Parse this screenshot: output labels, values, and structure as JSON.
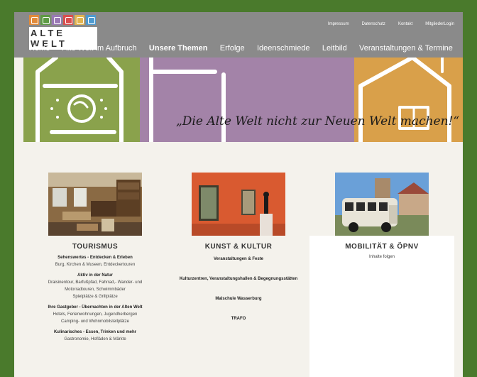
{
  "logo": {
    "text": "ALTE WELT",
    "tile_colors": [
      "#e08a3a",
      "#5d9a44",
      "#9a79b5",
      "#d94e4e",
      "#e2b44f",
      "#4d9ad0"
    ]
  },
  "meta_nav": [
    "Impressum",
    "Datenschutz",
    "Kontakt",
    "MitgliederLogin"
  ],
  "main_nav": [
    "Home",
    "Alte Welt im Aufbruch",
    "Unsere Themen",
    "Erfolge",
    "Ideenschmiede",
    "Leitbild",
    "Veranstaltungen & Termine"
  ],
  "active_nav": "Unsere Themen",
  "banner": {
    "slogan": "„Die Alte Welt nicht zur Neuen Welt machen!“"
  },
  "columns": {
    "tourismus": {
      "title": "TOURISMUS",
      "entries": [
        {
          "title": "Sehenswertes - Entdecken & Erleben",
          "lines": [
            "Burg, Kirchen & Museen, Entdeckertouren"
          ]
        },
        {
          "title": "Aktiv in der Natur",
          "lines": [
            "Draisinentour, Barfußpfad, Fahrrad,- Wander- und",
            "Motorradtouren, Schwimmbäder",
            "Spielplätze & Grillplätze"
          ]
        },
        {
          "title": "Ihre Gastgeber - Übernachten in der Alten Welt",
          "lines": [
            "Hotels, Ferienwohnungen, Jugendherbergen",
            "Camping- und Wohnmobilstellplätze"
          ]
        },
        {
          "title": "Kulinarisches - Essen, Trinken und mehr",
          "lines": [
            "Gastronomie, Hofläden & Märkte"
          ]
        }
      ]
    },
    "kunst": {
      "title": "KUNST & KULTUR",
      "entries": [
        "Veranstaltungen & Feste",
        "Kulturzentren, Veranstaltungshallen & Begegnungsstätten",
        "Malschule Wasserburg",
        "TRAFO"
      ]
    },
    "mobilitaet": {
      "title": "MOBILITÄT & ÖPNV",
      "text": "Inhalte folgen"
    }
  }
}
